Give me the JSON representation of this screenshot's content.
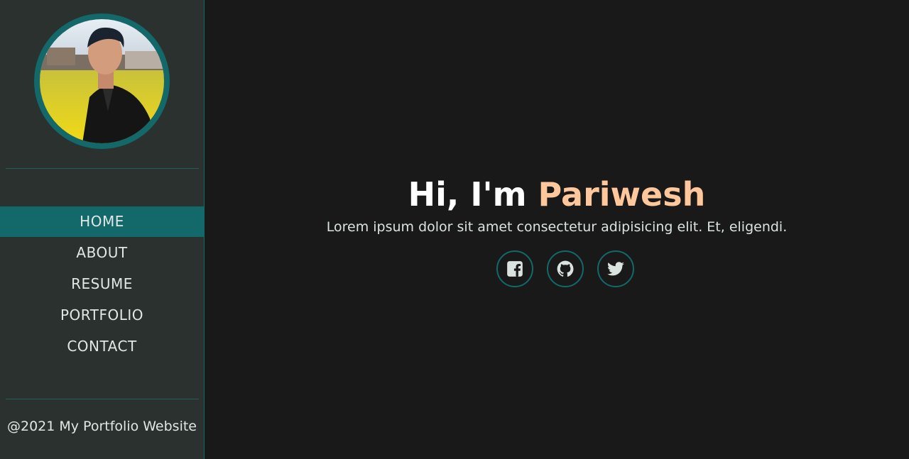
{
  "sidebar": {
    "avatar_alt": "Profile photo",
    "nav": [
      {
        "label": "HOME",
        "active": true
      },
      {
        "label": "ABOUT",
        "active": false
      },
      {
        "label": "RESUME",
        "active": false
      },
      {
        "label": "PORTFOLIO",
        "active": false
      },
      {
        "label": "CONTACT",
        "active": false
      }
    ],
    "footer": "@2021 My Portfolio Website"
  },
  "hero": {
    "greeting": "Hi, I'm ",
    "name": "Pariwesh",
    "subtitle": "Lorem ipsum dolor sit amet consectetur adipisicing elit. Et, eligendi."
  },
  "socials": [
    {
      "icon": "facebook-icon"
    },
    {
      "icon": "github-icon"
    },
    {
      "icon": "twitter-icon"
    }
  ],
  "colors": {
    "accent": "#13686a",
    "highlight": "#ffc79b",
    "sidebar_bg": "#2a312f",
    "page_bg": "#191919",
    "text": "#e0e7e4"
  }
}
